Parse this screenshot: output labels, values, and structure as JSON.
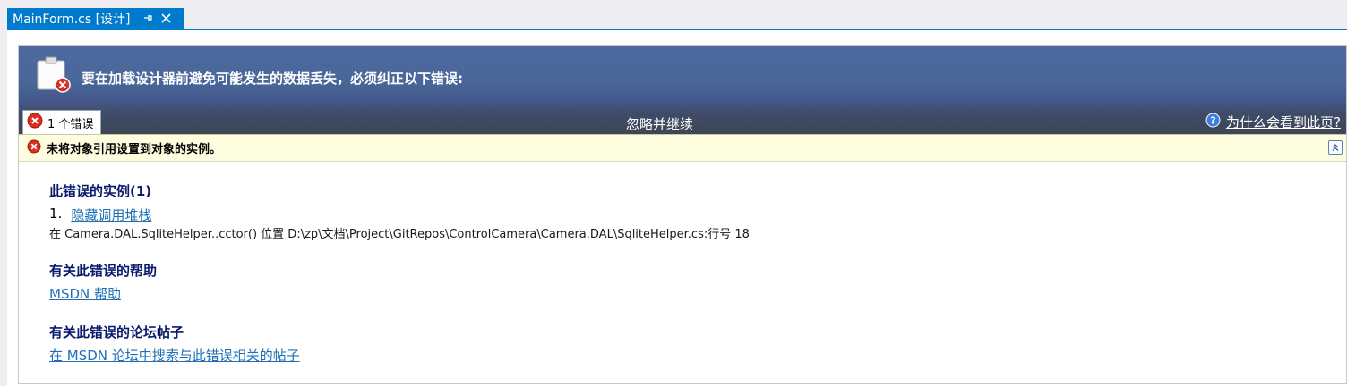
{
  "tab": {
    "title": "MainForm.cs [设计]",
    "pin_icon": "pin-icon",
    "close_icon": "close-icon",
    "accent": "#007acc"
  },
  "banner": {
    "title": "要在加载设计器前避免可能发生的数据丢失，必须纠正以下错误:",
    "error_tab_label": "1 个错误",
    "ignore_label": "忽略并继续",
    "help_label": "为什么会看到此页?"
  },
  "error": {
    "message": "未将对象引用设置到对象的实例。"
  },
  "details": {
    "instances_heading": "此错误的实例(1)",
    "item_number": "1.",
    "hide_stack_label": "隐藏调用堆栈",
    "stack_trace": "在 Camera.DAL.SqliteHelper..cctor() 位置 D:\\zp\\文档\\Project\\GitRepos\\ControlCamera\\Camera.DAL\\SqliteHelper.cs:行号 18",
    "help_heading": "有关此错误的帮助",
    "msdn_help_label": "MSDN 帮助",
    "forum_heading": "有关此错误的论坛帖子",
    "forum_search_label": "在 MSDN 论坛中搜索与此错误相关的帖子"
  },
  "colors": {
    "banner_top": "#4c6aa0",
    "banner_bottom": "#3e4656",
    "error_bar_bg": "#fffddf",
    "heading": "#0a1a6b",
    "link": "#1e6fb6",
    "error_red": "#d9301e"
  }
}
